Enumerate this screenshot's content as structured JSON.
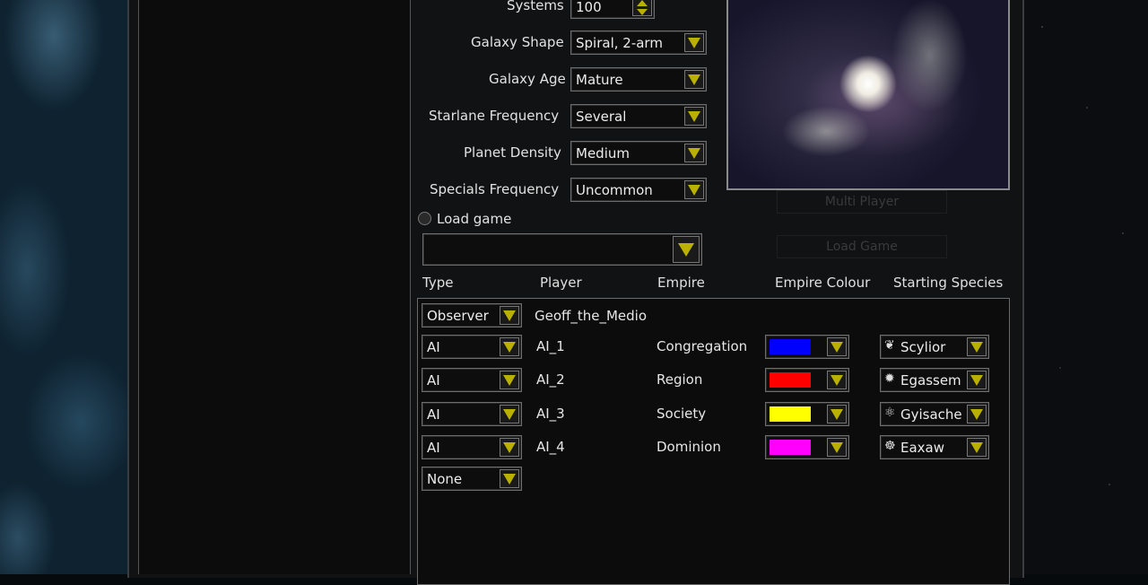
{
  "options": {
    "systems": {
      "label": "Systems",
      "value": "100"
    },
    "galaxy_shape": {
      "label": "Galaxy Shape",
      "value": "Spiral, 2-arm"
    },
    "galaxy_age": {
      "label": "Galaxy Age",
      "value": "Mature"
    },
    "starlane_frequency": {
      "label": "Starlane Frequency",
      "value": "Several"
    },
    "planet_density": {
      "label": "Planet Density",
      "value": "Medium"
    },
    "specials_frequency": {
      "label": "Specials Frequency",
      "value": "Uncommon"
    }
  },
  "load_game": {
    "label": "Load game",
    "selected": false,
    "value": ""
  },
  "ghost_menu": [
    "Multi Player",
    "Load Game"
  ],
  "columns": {
    "type": "Type",
    "player": "Player",
    "empire": "Empire",
    "empire_colour": "Empire Colour",
    "starting_species": "Starting Species"
  },
  "players": [
    {
      "type": "Observer",
      "player": "Geoff_the_Medio"
    },
    {
      "type": "AI",
      "player": "AI_1",
      "empire": "Congregation",
      "colour": "#0000ff",
      "species": "Scylior",
      "species_icon": "species-scylior-icon"
    },
    {
      "type": "AI",
      "player": "AI_2",
      "empire": "Region",
      "colour": "#ff0000",
      "species": "Egassem",
      "species_icon": "species-egassem-icon"
    },
    {
      "type": "AI",
      "player": "AI_3",
      "empire": "Society",
      "colour": "#ffff00",
      "species": "Gyisache",
      "species_icon": "species-gyisache-icon"
    },
    {
      "type": "AI",
      "player": "AI_4",
      "empire": "Dominion",
      "colour": "#ff00ff",
      "species": "Eaxaw",
      "species_icon": "species-eaxaw-icon"
    },
    {
      "type": "None"
    }
  ]
}
